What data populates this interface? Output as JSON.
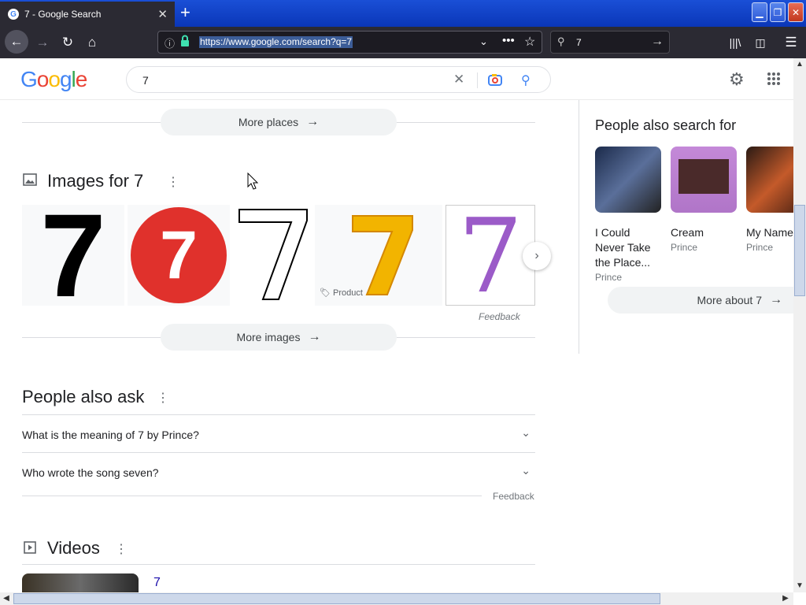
{
  "browser": {
    "tab_title": "7 - Google Search",
    "url": "https://www.google.com/search?q=7",
    "search_value": "7"
  },
  "google": {
    "query": "7",
    "logo_letters": [
      "G",
      "o",
      "o",
      "g",
      "l",
      "e"
    ],
    "logo_colors": [
      "#4285f4",
      "#ea4335",
      "#fbbc05",
      "#4285f4",
      "#34a853",
      "#ea4335"
    ]
  },
  "places": {
    "more_label": "More places"
  },
  "images": {
    "title": "Images for 7",
    "product_label": "Product",
    "feedback": "Feedback",
    "more_label": "More images"
  },
  "paa": {
    "title": "People also ask",
    "questions": [
      "What is the meaning of 7 by Prince?",
      "Who wrote the song seven?"
    ],
    "feedback": "Feedback"
  },
  "videos": {
    "title": "Videos",
    "first_title": "7"
  },
  "side": {
    "title": "People also search for",
    "items": [
      {
        "name": "I Could Never Take the Place...",
        "sub": "Prince"
      },
      {
        "name": "Cream",
        "sub": "Prince"
      },
      {
        "name": "My Name Prince",
        "sub": "Prince"
      }
    ],
    "more_label": "More about 7"
  }
}
